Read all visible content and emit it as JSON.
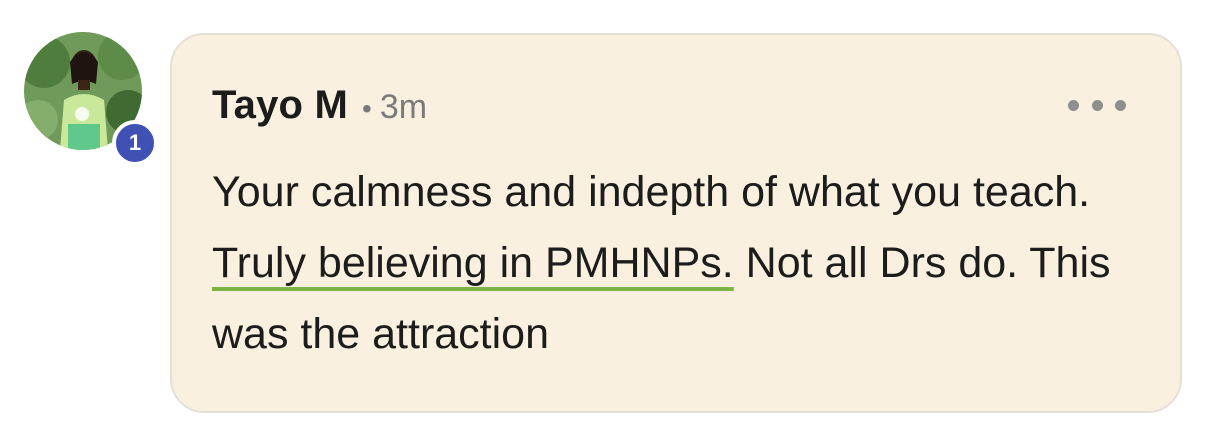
{
  "comment": {
    "author": "Tayo M",
    "separator": "•",
    "time": "3m",
    "badge_count": "1",
    "text_before": "Your calmness and indepth of what you teach. ",
    "text_highlight": "Truly believing in PMHNPs.",
    "text_after": " Not all Drs do. This was the attraction",
    "more_icon": "more-horizontal-icon",
    "colors": {
      "bubble_bg": "#f9f0df",
      "badge": "#3f51b5",
      "highlight_underline": "#7cb342",
      "meta_text": "#7a7a7a"
    }
  }
}
